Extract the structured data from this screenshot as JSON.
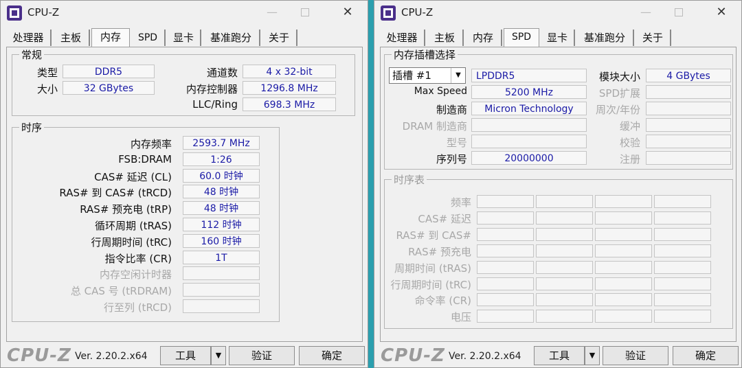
{
  "app": {
    "title": "CPU-Z",
    "brand": "CPU-Z",
    "version": "Ver. 2.20.2.x64",
    "buttons": {
      "tools": "工具",
      "validate": "验证",
      "ok": "确定",
      "dropdown_arrow": "▼"
    },
    "window_controls": {
      "minimize": "—",
      "close": "✕"
    },
    "icon": "cpu-z-app-icon"
  },
  "tabs": [
    "处理器",
    "主板",
    "内存",
    "SPD",
    "显卡",
    "基准跑分",
    "关于"
  ],
  "memory": {
    "active_tab": "内存",
    "general": {
      "title": "常规",
      "type_label": "类型",
      "type": "DDR5",
      "size_label": "大小",
      "size": "32 GBytes",
      "channels_label": "通道数",
      "channels": "4 x 32-bit",
      "mc_label": "内存控制器",
      "mc": "1296.8 MHz",
      "llc_label": "LLC/Ring",
      "llc": "698.3 MHz"
    },
    "timings": {
      "title": "时序",
      "rows": [
        {
          "label": "内存频率",
          "value": "2593.7 MHz",
          "dim": false
        },
        {
          "label": "FSB:DRAM",
          "value": "1:26",
          "dim": false
        },
        {
          "label": "CAS# 延迟 (CL)",
          "value": "60.0 时钟",
          "dim": false
        },
        {
          "label": "RAS# 到 CAS# (tRCD)",
          "value": "48 时钟",
          "dim": false
        },
        {
          "label": "RAS# 预充电 (tRP)",
          "value": "48 时钟",
          "dim": false
        },
        {
          "label": "循环周期 (tRAS)",
          "value": "112 时钟",
          "dim": false
        },
        {
          "label": "行周期时间 (tRC)",
          "value": "160 时钟",
          "dim": false
        },
        {
          "label": "指令比率 (CR)",
          "value": "1T",
          "dim": false
        },
        {
          "label": "内存空闲计时器",
          "value": "",
          "dim": true
        },
        {
          "label": "总 CAS 号 (tRDRAM)",
          "value": "",
          "dim": true
        },
        {
          "label": "行至列 (tRCD)",
          "value": "",
          "dim": true
        }
      ]
    }
  },
  "spd": {
    "active_tab": "SPD",
    "slot_group": {
      "title": "内存插槽选择",
      "slot_value": "插槽 #1",
      "type": "LPDDR5",
      "module_size_label": "模块大小",
      "module_size": "4 GBytes",
      "max_speed_label": "Max Speed",
      "max_speed": "5200 MHz",
      "spd_ext_label": "SPD扩展",
      "manufacturer_label": "制造商",
      "manufacturer": "Micron Technology",
      "week_year_label": "周次/年份",
      "dram_mfr_label": "DRAM 制造商",
      "buffered_label": "缓冲",
      "part_label": "型号",
      "check_label": "校验",
      "serial_label": "序列号",
      "serial": "20000000",
      "registered_label": "注册"
    },
    "timing_table": {
      "title": "时序表",
      "rows": [
        "频率",
        "CAS# 延迟",
        "RAS# 到 CAS#",
        "RAS# 预充电",
        "周期时间 (tRAS)",
        "行周期时间 (tRC)",
        "命令率 (CR)",
        "电压"
      ]
    }
  }
}
